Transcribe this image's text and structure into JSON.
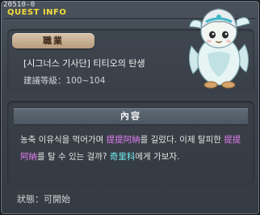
{
  "window": {
    "quest_id": "20510-0",
    "title": "QUEST INFO"
  },
  "info": {
    "job_tag": "職業",
    "quest_name": "[시그너스 기사단] 티티오의 탄생",
    "level_label": "建議等級：",
    "level_range": "100~104"
  },
  "content": {
    "header": "內容",
    "segments": [
      {
        "text": "농축 이유식을 먹어가며 ",
        "type": "plain"
      },
      {
        "text": "提提阿納",
        "type": "name"
      },
      {
        "text": "를 길렀다. 이제 탈피한 ",
        "type": "plain"
      },
      {
        "text": "提提阿納",
        "type": "name"
      },
      {
        "text": "를 탈 수 있는 걸까? ",
        "type": "plain"
      },
      {
        "text": "奇里科",
        "type": "place"
      },
      {
        "text": "에게 가보자.",
        "type": "plain"
      }
    ]
  },
  "status": {
    "label": "狀態：",
    "value": "可開始"
  },
  "colors": {
    "title_yellow": "#f4dc3c",
    "highlight_name": "#e27df4",
    "highlight_place": "#74f0f6",
    "job_tag": "#c9b190"
  },
  "npc": {
    "icon": "titio-npc-sprite"
  }
}
